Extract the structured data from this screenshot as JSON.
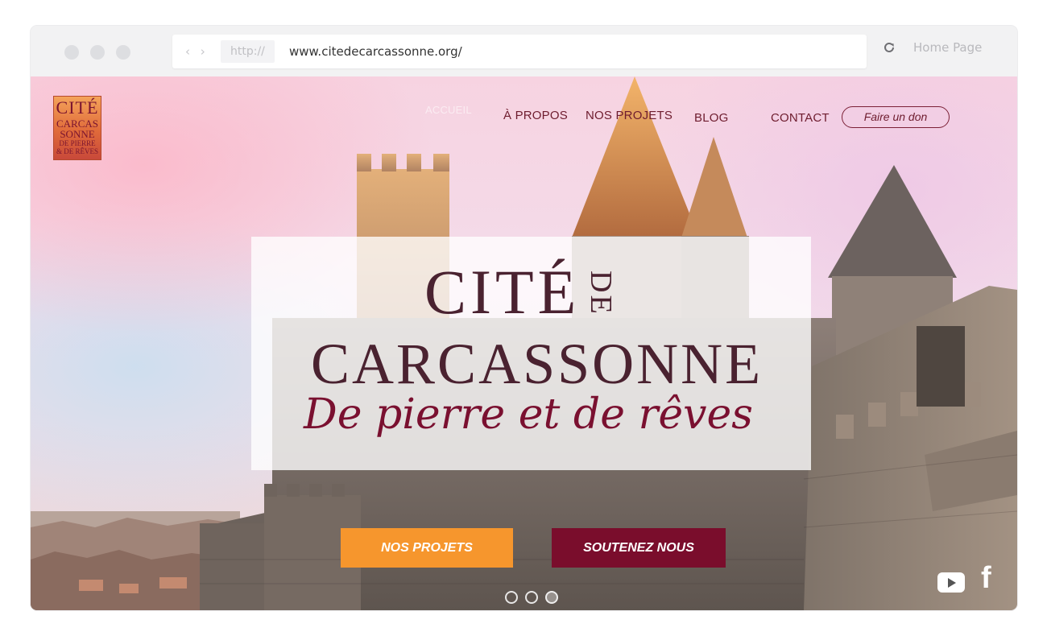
{
  "browser": {
    "nav_arrows": "‹ ›",
    "protocol": "http://",
    "url": "www.citedecarcassonne.org/",
    "home_label": "Home Page"
  },
  "site": {
    "logo": {
      "line1": "CITÉ",
      "line2": "CARCAS",
      "line3": "SONNE",
      "line4": "DE PIERRE",
      "line5": "& DE RÊVES"
    },
    "nav": {
      "faded_item": "ACCUEIL",
      "about": "À PROPOS",
      "projects": "NOS PROJETS",
      "blog": "BLOG",
      "contact": "CONTACT",
      "donate": "Faire un don"
    },
    "hero": {
      "title_cite": "CITÉ",
      "title_de": "DE",
      "title_carcassonne": "CARCASSONNE",
      "subtitle": "De pierre et de rêves",
      "btn_projects": "NOS PROJETS",
      "btn_support": "SOUTENEZ NOUS",
      "carousel_count": 3,
      "carousel_active": 3
    },
    "social": {
      "youtube": "youtube-icon",
      "facebook_glyph": "f"
    },
    "colors": {
      "orange": "#f6962d",
      "burgundy": "#7a0d2c",
      "title": "#4a2230"
    }
  }
}
